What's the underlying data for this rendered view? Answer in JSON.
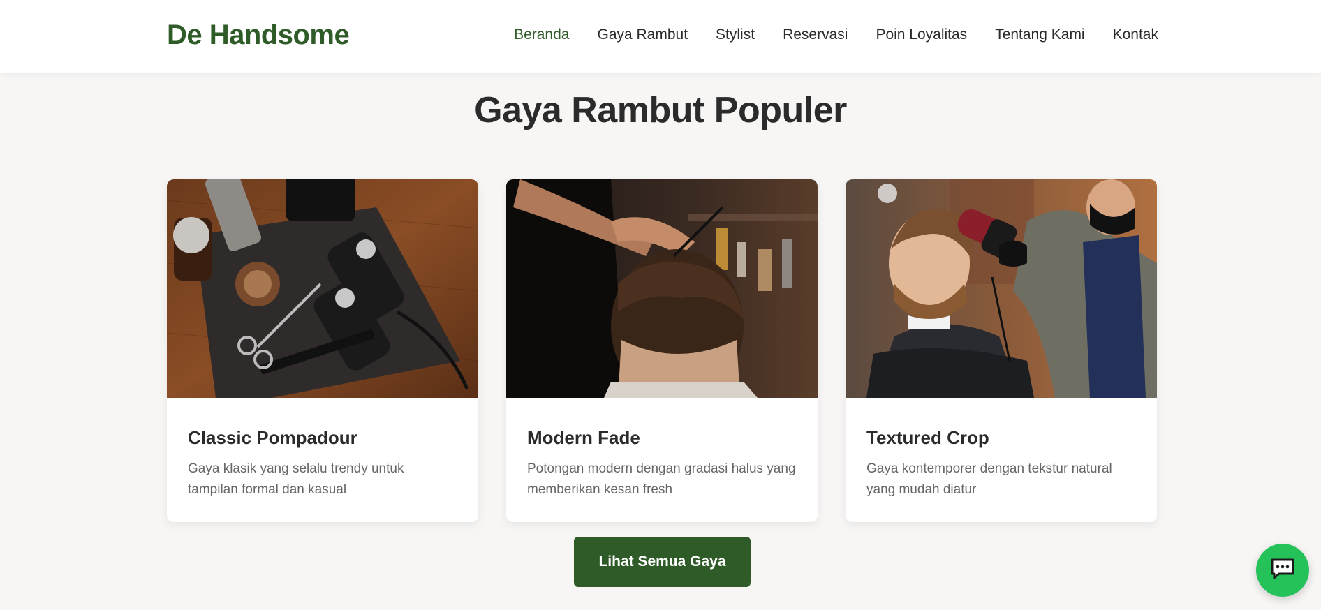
{
  "header": {
    "brand": "De Handsome",
    "nav": [
      {
        "label": "Beranda",
        "active": true
      },
      {
        "label": "Gaya Rambut",
        "active": false
      },
      {
        "label": "Stylist",
        "active": false
      },
      {
        "label": "Reservasi",
        "active": false
      },
      {
        "label": "Poin Loyalitas",
        "active": false
      },
      {
        "label": "Tentang Kami",
        "active": false
      },
      {
        "label": "Kontak",
        "active": false
      }
    ]
  },
  "section": {
    "title": "Gaya Rambut Populer",
    "cards": [
      {
        "title": "Classic Pompadour",
        "description": "Gaya klasik yang selalu trendy untuk tampilan formal dan kasual",
        "image": "barber-tools-photo"
      },
      {
        "title": "Modern Fade",
        "description": "Potongan modern dengan gradasi halus yang memberikan kesan fresh",
        "image": "haircut-back-view-photo"
      },
      {
        "title": "Textured Crop",
        "description": "Gaya kontemporer dengan tekstur natural yang mudah diatur",
        "image": "barber-blowdry-photo"
      }
    ],
    "cta_label": "Lihat Semua Gaya"
  },
  "chat_widget": {
    "icon": "chat-icon"
  },
  "colors": {
    "brand_green": "#2e5b27",
    "chat_green": "#25c25a",
    "background": "#f7f6f5"
  }
}
